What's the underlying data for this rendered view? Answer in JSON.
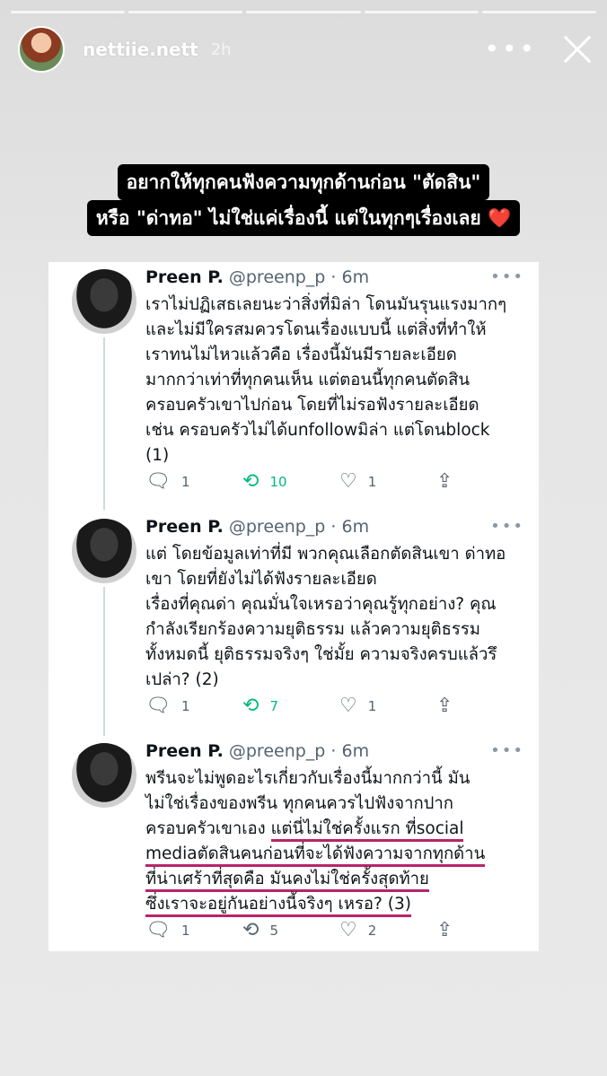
{
  "story": {
    "username": "nettiie.nett",
    "time": "2h",
    "progress_segments": 5,
    "caption": {
      "line1": "อยากให้ทุกคนฟังความทุกด้านก่อน \"ตัดสิน\"",
      "line2": "หรือ \"ด่าทอ\" ไม่ใช่แค่เรื่องนี้ แต่ในทุกๆเรื่องเลย",
      "emoji": "❤️"
    }
  },
  "tweets": [
    {
      "name": "Preen P.",
      "handle": "@preenp_p · 6m",
      "lines": [
        "เราไม่ปฏิเสธเลยนะว่าสิ่งที่มิล่า โดนมันรุนแรงมากๆ",
        "และไม่มีใครสมควรโดนเรื่องแบบนี้ แต่สิ่งที่ทำให้",
        "เราทนไม่ไหวแล้วคือ เรื่องนี้มันมีรายละเอียด",
        "มากกว่าเท่าที่ทุกคนเห็น แต่ตอนนี้ทุกคนตัดสิน",
        "ครอบครัวเขาไปก่อน โดยที่ไม่รอฟังรายละเอียด",
        "เช่น ครอบครัวไม่ได้unfollowมิล่า แต่โดนblock",
        "(1)"
      ],
      "replies": "1",
      "retweets": "10",
      "likes": "1"
    },
    {
      "name": "Preen P.",
      "handle": "@preenp_p · 6m",
      "lines": [
        "แต่ โดยข้อมูลเท่าที่มี พวกคุณเลือกตัดสินเขา ด่าทอ",
        "เขา โดยที่ยังไม่ได้ฟังรายละเอียด",
        "เรื่องที่คุณด่า คุณมั่นใจเหรอว่าคุณรู้ทุกอย่าง? คุณ",
        "กำลังเรียกร้องความยุติธรรม แล้วความยุติธรรม",
        "ทั้งหมดนี้ ยุติธรรมจริงๆ ใช่มั้ย ความจริงครบแล้วรึ",
        "เปล่า? (2)"
      ],
      "replies": "1",
      "retweets": "7",
      "likes": "1"
    },
    {
      "name": "Preen P.",
      "handle": "@preenp_p · 6m",
      "lines": [
        "พรีนจะไม่พูดอะไรเกี่ยวกับเรื่องนี้มากกว่านี้ มัน",
        "ไม่ใช่เรื่องของพรีน ทุกคนควรไปฟังจากปาก",
        "ครอบครัวเขาเอง ",
        "แต่นี่ไม่ใช่ครั้งแรก ที่social",
        "mediaตัดสินคนก่อนที่จะได้ฟังความจากทุกด้าน",
        "ที่น่าเศร้าที่สุดคือ มันคงไม่ใช่ครั้งสุดท้าย",
        "ซึ่งเราจะอยู่กันอย่างนี้จริงๆ เหรอ? (3)"
      ],
      "replies": "1",
      "retweets": "5",
      "likes": "2"
    }
  ],
  "colors": {
    "retweet_active": "#00ba7c",
    "highlight_underline": "#b8246a",
    "heart": "#e0245e"
  },
  "icons": [
    "close-icon",
    "more-icon",
    "reply-icon",
    "retweet-icon",
    "like-icon",
    "share-icon"
  ]
}
